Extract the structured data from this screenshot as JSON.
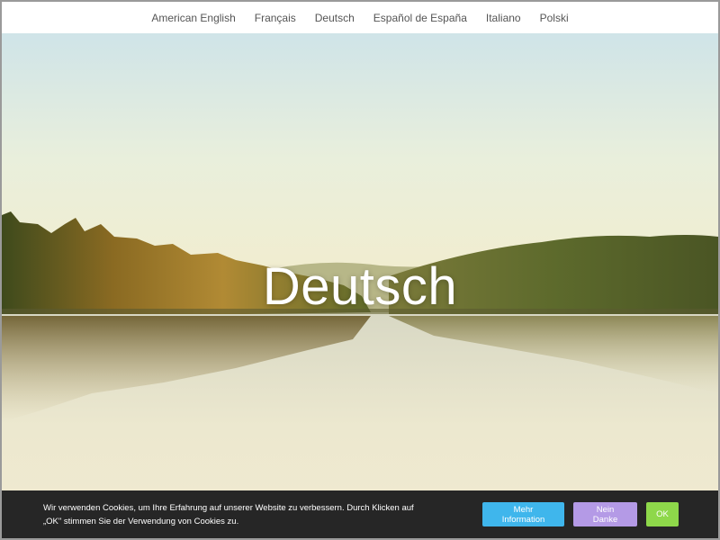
{
  "nav": {
    "items": [
      {
        "label": "American English"
      },
      {
        "label": "Français"
      },
      {
        "label": "Deutsch"
      },
      {
        "label": "Español de España"
      },
      {
        "label": "Italiano"
      },
      {
        "label": "Polski"
      }
    ]
  },
  "hero": {
    "title": "Deutsch"
  },
  "cookie": {
    "text": "Wir verwenden Cookies, um Ihre Erfahrung auf unserer Website zu verbessern. Durch Klicken auf „OK\" stimmen Sie der Verwendung von Cookies zu.",
    "info_label": "Mehr Information",
    "decline_label": "Nein Danke",
    "ok_label": "OK",
    "colors": {
      "bar": "#262626",
      "info": "#3fb6ec",
      "decline": "#b49ae6",
      "ok": "#8ed84a"
    }
  }
}
